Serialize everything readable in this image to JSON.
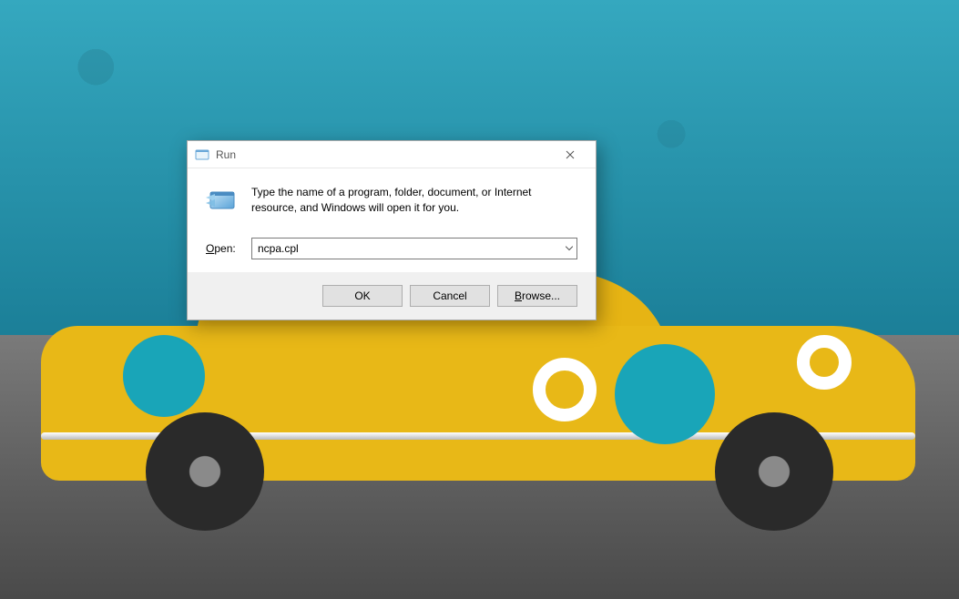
{
  "dialog": {
    "title": "Run",
    "description": "Type the name of a program, folder, document, or Internet resource, and Windows will open it for you.",
    "open_label_prefix": "O",
    "open_label_rest": "pen:",
    "input_value": "ncpa.cpl",
    "buttons": {
      "ok": "OK",
      "cancel": "Cancel",
      "browse_prefix": "B",
      "browse_rest": "rowse..."
    }
  }
}
